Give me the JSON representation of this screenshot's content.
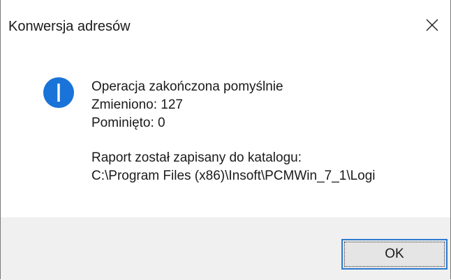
{
  "window": {
    "title": "Konwersja adresów",
    "close_icon": "close-icon"
  },
  "message": {
    "icon": "info-icon",
    "icon_color": "#1a73d9",
    "lines": [
      "Operacja zakończona pomyślnie",
      "Zmieniono: 127",
      "Pominięto: 0"
    ],
    "report_lines": [
      "Raport został zapisany do katalogu:",
      "C:\\Program Files (x86)\\Insoft\\PCMWin_7_1\\Logi"
    ]
  },
  "buttons": {
    "ok_label": "OK"
  }
}
